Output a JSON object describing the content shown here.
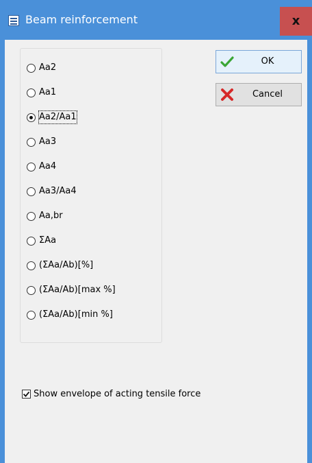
{
  "window": {
    "title": "Beam reinforcement",
    "close_label": "x"
  },
  "reinforcement_options": {
    "selected": "Aa2/Aa1",
    "items": [
      {
        "label": "Aa2",
        "checked": false
      },
      {
        "label": "Aa1",
        "checked": false
      },
      {
        "label": "Aa2/Aa1",
        "checked": true
      },
      {
        "label": "Aa3",
        "checked": false
      },
      {
        "label": "Aa4",
        "checked": false
      },
      {
        "label": "Aa3/Aa4",
        "checked": false
      },
      {
        "label": "Aa,br",
        "checked": false
      },
      {
        "label": "ΣAa",
        "checked": false
      },
      {
        "label": "(ΣAa/Ab)[%]",
        "checked": false
      },
      {
        "label": "(ΣAa/Ab)[max %]",
        "checked": false
      },
      {
        "label": "(ΣAa/Ab)[min %]",
        "checked": false
      }
    ]
  },
  "buttons": {
    "ok_label": "OK",
    "cancel_label": "Cancel",
    "ok_icon": "checkmark-icon",
    "cancel_icon": "red-x-icon",
    "ok_icon_color": "#3aa635",
    "cancel_icon_color": "#d62828"
  },
  "envelope_checkbox": {
    "label": "Show envelope of acting tensile force",
    "checked": true
  },
  "colors": {
    "titlebar": "#4a90d9",
    "close_button": "#c75050",
    "client_background": "#f0f0f0"
  }
}
